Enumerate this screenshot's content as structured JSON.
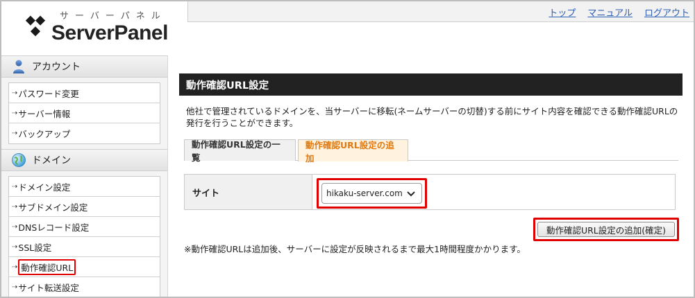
{
  "logo": {
    "kana": "サーバーパネル",
    "text": "ServerPanel"
  },
  "topnav": [
    {
      "label": "トップ"
    },
    {
      "label": "マニュアル"
    },
    {
      "label": "ログアウト"
    }
  ],
  "sidebar": {
    "sections": [
      {
        "title": "アカウント",
        "icon": "user-icon",
        "items": [
          {
            "label": "パスワード変更"
          },
          {
            "label": "サーバー情報"
          },
          {
            "label": "バックアップ"
          }
        ]
      },
      {
        "title": "ドメイン",
        "icon": "globe-icon",
        "items": [
          {
            "label": "ドメイン設定"
          },
          {
            "label": "サブドメイン設定"
          },
          {
            "label": "DNSレコード設定"
          },
          {
            "label": "SSL設定"
          },
          {
            "label": "動作確認URL"
          },
          {
            "label": "サイト転送設定"
          }
        ]
      }
    ]
  },
  "main": {
    "title": "動作確認URL設定",
    "description": "他社で管理されているドメインを、当サーバーに移転(ネームサーバーの切替)する前にサイト内容を確認できる動作確認URLの発行を行うことができます。",
    "tabs": [
      {
        "label": "動作確認URL設定の一覧",
        "active": false
      },
      {
        "label": "動作確認URL設定の追加",
        "active": true
      }
    ],
    "form": {
      "site_label": "サイト",
      "site_value": "hikaku-server.com"
    },
    "submit_label": "動作確認URL設定の追加(確定)",
    "note": "※動作確認URLは追加後、サーバーに設定が反映されるまで最大1時間程度かかります。"
  },
  "colors": {
    "accent_tab_text": "#e07a10",
    "highlight_border": "#e00000",
    "link": "#2a5db0",
    "title_bar": "#222222"
  }
}
